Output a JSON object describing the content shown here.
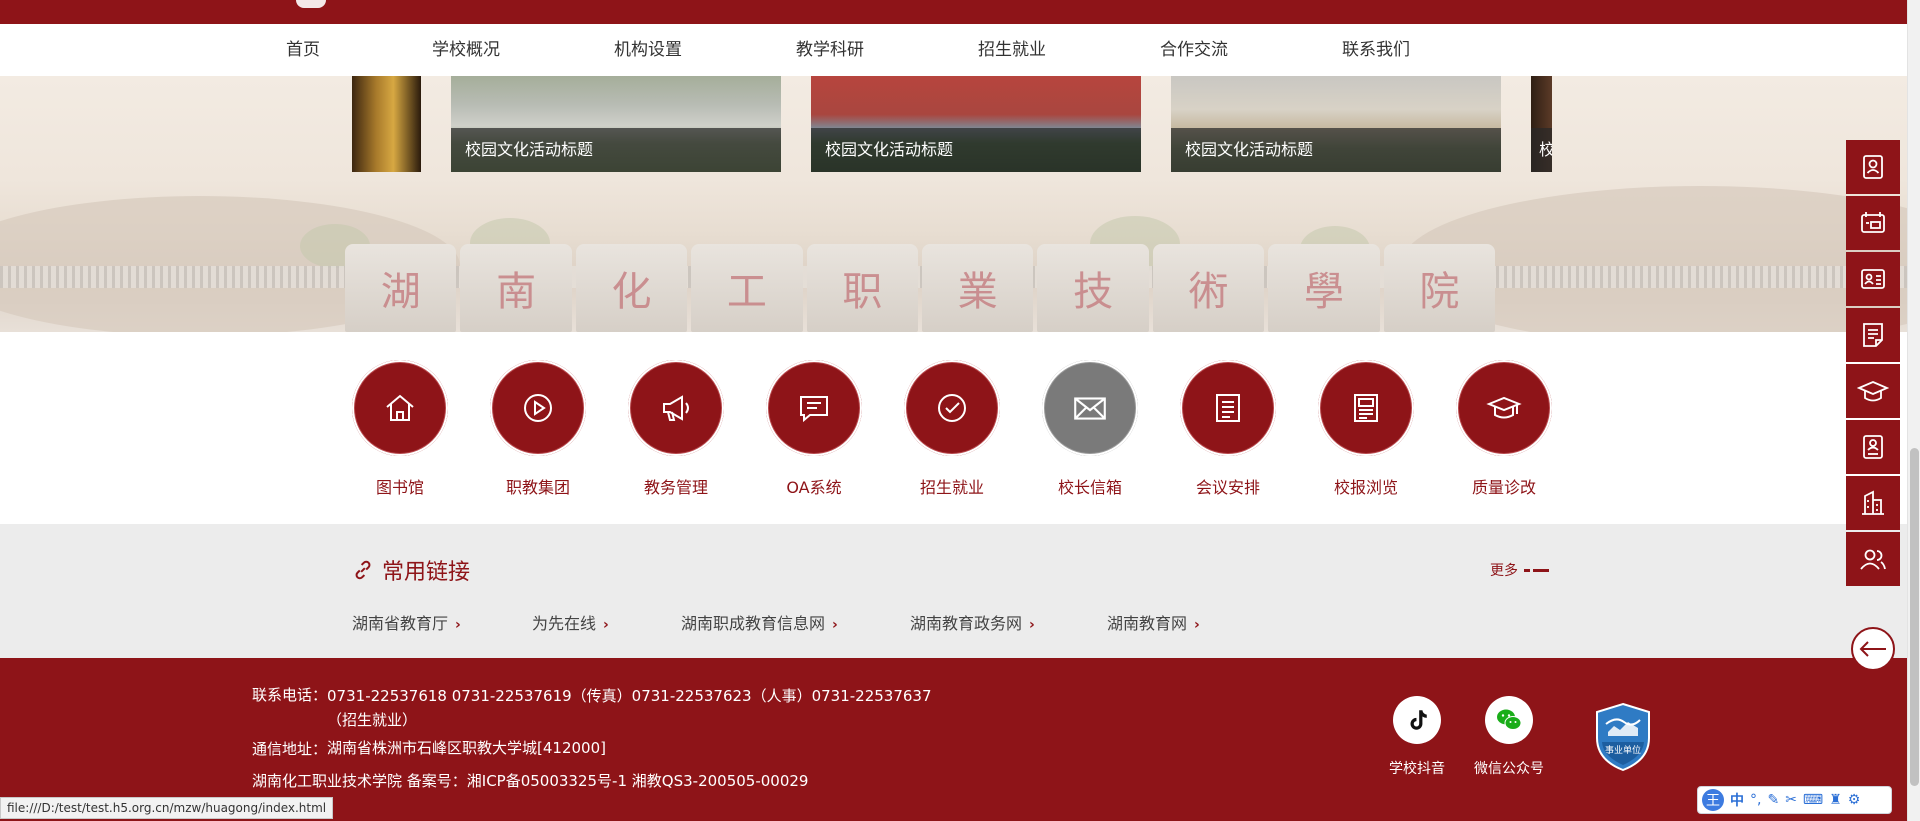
{
  "nav": {
    "items": [
      "首页",
      "学校概况",
      "机构设置",
      "教学科研",
      "招生就业",
      "合作交流",
      "联系我们"
    ]
  },
  "slider": {
    "captions": [
      "校园文化活动标题",
      "校园文化活动标题",
      "校园文化活动标题",
      "校"
    ],
    "stone_text": [
      "湖",
      "南",
      "化",
      "工",
      "职",
      "業",
      "技",
      "術",
      "學",
      "院"
    ]
  },
  "quick_links": [
    {
      "label": "图书馆",
      "icon": "home-icon"
    },
    {
      "label": "职教集团",
      "icon": "play-icon"
    },
    {
      "label": "教务管理",
      "icon": "megaphone-icon"
    },
    {
      "label": "OA系统",
      "icon": "message-icon"
    },
    {
      "label": "招生就业",
      "icon": "check-icon"
    },
    {
      "label": "校长信箱",
      "icon": "mail-icon"
    },
    {
      "label": "会议安排",
      "icon": "list-icon"
    },
    {
      "label": "校报浏览",
      "icon": "newspaper-icon"
    },
    {
      "label": "质量诊改",
      "icon": "graduation-cap-icon"
    }
  ],
  "common_links": {
    "title": "常用链接",
    "more": "更多",
    "items": [
      "湖南省教育厅",
      "为先在线",
      "湖南职成教育信息网",
      "湖南教育政务网",
      "湖南教育网"
    ],
    "chevron": "›"
  },
  "footer": {
    "phone_label": "联系电话：",
    "phone_value": "0731-22537618 0731-22537619（传真）0731-22537623（人事）0731-22537637（招生就业）",
    "address_label": "通信地址：",
    "address_value": "湖南省株洲市石峰区职教大学城[412000]",
    "icp": "湖南化工职业技术学院 备案号：湘ICP备05003325号-1 湘教QS3-200505-00029",
    "social": [
      {
        "label": "学校抖音",
        "icon": "tiktok-icon"
      },
      {
        "label": "微信公众号",
        "icon": "wechat-icon"
      }
    ],
    "badge_text": "事业单位"
  },
  "status_url": "file:///D:/test/test.h5.org.cn/mzw/huagong/index.html",
  "ime": {
    "logo": "王",
    "mode": "中"
  },
  "colors": {
    "brand": "#8e1418",
    "link_bg": "#ececec",
    "gray_circle": "#7a7a7a"
  },
  "sidebar_icons": [
    "contact-card-icon",
    "id-card-icon",
    "profile-card-icon",
    "notepad-icon",
    "graduation-cap-icon",
    "user-document-icon",
    "building-icon",
    "users-icon"
  ]
}
